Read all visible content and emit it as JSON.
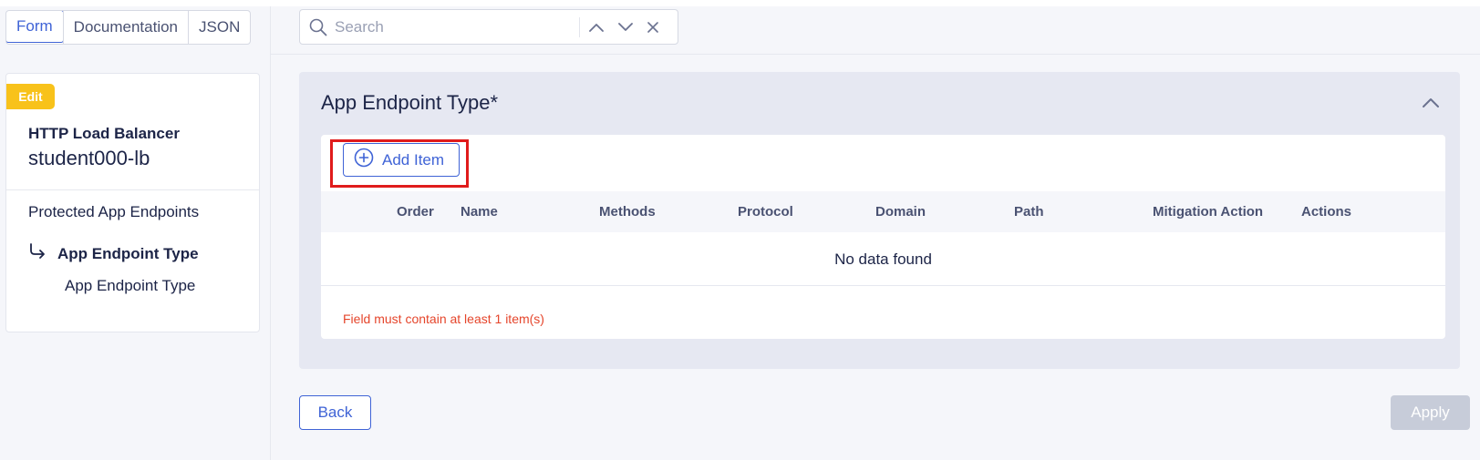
{
  "view_tabs": [
    {
      "label": "Form",
      "active": true
    },
    {
      "label": "Documentation",
      "active": false
    },
    {
      "label": "JSON",
      "active": false
    }
  ],
  "sidebar": {
    "badge": "Edit",
    "object_type": "HTTP Load Balancer",
    "object_name": "student000-lb",
    "nav_section": "Protected App Endpoints",
    "nav_active": "App Endpoint Type",
    "nav_sub": "App Endpoint Type"
  },
  "search": {
    "placeholder": "Search",
    "value": ""
  },
  "section": {
    "title": "App Endpoint Type*",
    "add_button": "Add Item",
    "columns": [
      "Order",
      "Name",
      "Methods",
      "Protocol",
      "Domain",
      "Path",
      "Mitigation Action",
      "Actions"
    ],
    "empty_text": "No data found",
    "error": "Field must contain at least 1 item(s)"
  },
  "footer": {
    "back": "Back",
    "apply": "Apply"
  },
  "colors": {
    "accent": "#3f63d6",
    "badge": "#f8c21a",
    "error": "#e5452b",
    "highlight": "#e01b1b",
    "disabled": "#c7ccd9"
  },
  "icons": {
    "search": "search-icon",
    "up": "chevron-up-icon",
    "down": "chevron-down-icon",
    "close": "close-icon",
    "collapse": "chevron-up-icon",
    "add": "plus-circle-icon",
    "nav_arrow": "turn-right-arrow-icon"
  }
}
